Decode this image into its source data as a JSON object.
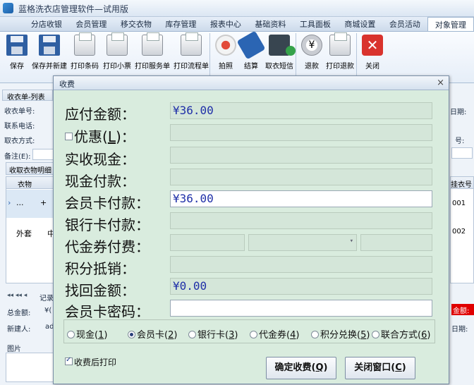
{
  "app": {
    "title": "蓝格洗衣店管理软件—试用版"
  },
  "tabs": [
    "分店收银",
    "会员管理",
    "移交衣物",
    "库存管理",
    "报表中心",
    "基础资料",
    "工具面板",
    "商城设置",
    "会员活动",
    "对象管理"
  ],
  "ribbon": {
    "buttons": [
      {
        "label": "保存",
        "icon": "save-icon"
      },
      {
        "label": "保存并新建",
        "icon": "save-new-icon"
      },
      {
        "label": "打印条码",
        "icon": "printer-icon"
      },
      {
        "label": "打印小票",
        "icon": "printer-icon"
      },
      {
        "label": "打印服务单",
        "icon": "printer-icon"
      },
      {
        "label": "打印流程单",
        "icon": "printer-icon"
      },
      {
        "label": "拍照",
        "icon": "camera-eye-icon"
      },
      {
        "label": "结算",
        "icon": "tag-icon"
      },
      {
        "label": "取衣短信",
        "icon": "phone-sms-icon"
      },
      {
        "label": "退款",
        "icon": "yen-coin-icon"
      },
      {
        "label": "打印退款",
        "icon": "printer-icon"
      },
      {
        "label": "关闭",
        "icon": "close-red-icon"
      }
    ]
  },
  "background": {
    "section_tab": "收衣单-列表",
    "labels": {
      "order_no": "收衣单号:",
      "phone": "联系电话:",
      "pickup_method": "取衣方式:",
      "remark": "备注(E):",
      "detail_tab": "收取衣物明细",
      "col_clothes": "衣物",
      "col_code": "挂衣号",
      "row1_cell": "...",
      "row1_plus": "+",
      "row1_code": "001",
      "row2_name": "外套",
      "row2_mid": "中",
      "row2_code": "002",
      "record": "记录",
      "total": "总金额:",
      "total_prefix": "¥(",
      "creator": "新建人:",
      "creator_value": "ad",
      "date_label": "日期:",
      "no_label": "号:",
      "total_right": "金额:",
      "date_label2": "日期:",
      "photo": "图片",
      "nav": "◂◂ ◂◂ ◂"
    }
  },
  "dialog": {
    "title": "收费",
    "close": "×",
    "fields": {
      "payable": {
        "label": "应付金额：",
        "value": "¥36.00"
      },
      "discount": {
        "label_prefix": "优惠(",
        "label_key": "L",
        "label_suffix": ")：",
        "value": ""
      },
      "cash_received": {
        "label": "实收现金：",
        "value": ""
      },
      "cash_pay": {
        "label": "现金付款：",
        "value": ""
      },
      "member_card_pay": {
        "label": "会员卡付款：",
        "value": "¥36.00"
      },
      "bank_card_pay": {
        "label": "银行卡付款：",
        "value": ""
      },
      "voucher_pay": {
        "label": "代金券付费：",
        "value": ""
      },
      "points": {
        "label": "积分抵销：",
        "value": ""
      },
      "change": {
        "label": "找回金额：",
        "value": "¥0.00"
      },
      "card_password": {
        "label": "会员卡密码：",
        "value": ""
      }
    },
    "payment_methods": [
      {
        "label": "现金(",
        "key": "1",
        "suffix": ")",
        "selected": false
      },
      {
        "label": "会员卡(",
        "key": "2",
        "suffix": ")",
        "selected": true
      },
      {
        "label": "银行卡(",
        "key": "3",
        "suffix": ")",
        "selected": false
      },
      {
        "label": "代金券(",
        "key": "4",
        "suffix": ")",
        "selected": false
      },
      {
        "label": "积分兑换(",
        "key": "5",
        "suffix": ")",
        "selected": false
      },
      {
        "label": "联合方式(",
        "key": "6",
        "suffix": ")",
        "selected": false
      }
    ],
    "print_after": {
      "label": "收费后打印",
      "checked": true
    },
    "confirm_button": {
      "label": "确定收费(",
      "key": "Q",
      "suffix": ")"
    },
    "close_button": {
      "label": "关闭窗口(",
      "key": "C",
      "suffix": ")"
    }
  }
}
